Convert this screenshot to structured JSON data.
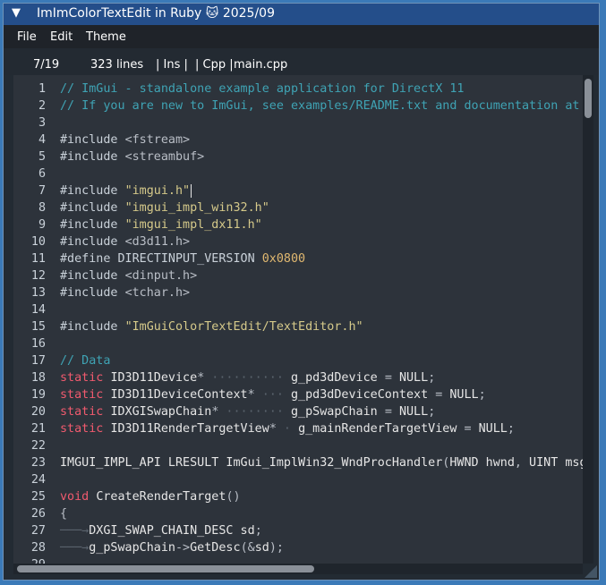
{
  "window": {
    "title": "ImImColorTextEdit in Ruby 🐱 2025/09",
    "collapse_glyph": "▼"
  },
  "menu": [
    {
      "label": "File"
    },
    {
      "label": "Edit"
    },
    {
      "label": "Theme"
    }
  ],
  "status": {
    "position": "7/19",
    "line_count": "323 lines",
    "mode": "| Ins |",
    "language": "| Cpp |",
    "filename": "main.cpp"
  },
  "colors": {
    "window_border": "#6f93b8",
    "titlebar": "#244e8a",
    "editor_bg": "#2d333b",
    "comment": "#3fa3b4",
    "string": "#d5c98a",
    "keyword": "#f05a6e",
    "number": "#e0b870"
  },
  "editor": {
    "cursor": {
      "line": 7,
      "column": 19
    },
    "lines": [
      {
        "n": "1",
        "tokens": [
          [
            "comment",
            "// ImGui - standalone example application for DirectX 11"
          ]
        ]
      },
      {
        "n": "2",
        "tokens": [
          [
            "comment",
            "// If you are new to ImGui, see examples/README.txt and documentation at the top"
          ]
        ]
      },
      {
        "n": "3",
        "tokens": []
      },
      {
        "n": "4",
        "tokens": [
          [
            "pre",
            "#include "
          ],
          [
            "punct",
            "<fstream>"
          ]
        ]
      },
      {
        "n": "5",
        "tokens": [
          [
            "pre",
            "#include "
          ],
          [
            "punct",
            "<streambuf>"
          ]
        ]
      },
      {
        "n": "6",
        "tokens": []
      },
      {
        "n": "7",
        "tokens": [
          [
            "pre",
            "#include "
          ],
          [
            "str",
            "\"imgui.h\""
          ]
        ],
        "cursor": true
      },
      {
        "n": "8",
        "tokens": [
          [
            "pre",
            "#include "
          ],
          [
            "str",
            "\"imgui_impl_win32.h\""
          ]
        ]
      },
      {
        "n": "9",
        "tokens": [
          [
            "pre",
            "#include "
          ],
          [
            "str",
            "\"imgui_impl_dx11.h\""
          ]
        ]
      },
      {
        "n": "10",
        "tokens": [
          [
            "pre",
            "#include "
          ],
          [
            "punct",
            "<d3d11.h>"
          ]
        ]
      },
      {
        "n": "11",
        "tokens": [
          [
            "pre",
            "#define DIRECTINPUT_VERSION "
          ],
          [
            "num",
            "0x0800"
          ]
        ]
      },
      {
        "n": "12",
        "tokens": [
          [
            "pre",
            "#include "
          ],
          [
            "punct",
            "<dinput.h>"
          ]
        ]
      },
      {
        "n": "13",
        "tokens": [
          [
            "pre",
            "#include "
          ],
          [
            "punct",
            "<tchar.h>"
          ]
        ]
      },
      {
        "n": "14",
        "tokens": []
      },
      {
        "n": "15",
        "tokens": [
          [
            "pre",
            "#include "
          ],
          [
            "str",
            "\"ImGuiColorTextEdit/TextEditor.h\""
          ]
        ]
      },
      {
        "n": "16",
        "tokens": []
      },
      {
        "n": "17",
        "tokens": [
          [
            "comment",
            "// Data"
          ]
        ]
      },
      {
        "n": "18",
        "tokens": [
          [
            "kw",
            "static "
          ],
          [
            "ident",
            "ID3D11Device"
          ],
          [
            "punct",
            "*"
          ],
          [
            "ws",
            " ·········· "
          ],
          [
            "ident",
            "g_pd3dDevice "
          ],
          [
            "punct",
            "= "
          ],
          [
            "ident",
            "NULL"
          ],
          [
            "punct",
            ";"
          ]
        ]
      },
      {
        "n": "19",
        "tokens": [
          [
            "kw",
            "static "
          ],
          [
            "ident",
            "ID3D11DeviceContext"
          ],
          [
            "punct",
            "*"
          ],
          [
            "ws",
            " ··· "
          ],
          [
            "ident",
            "g_pd3dDeviceContext "
          ],
          [
            "punct",
            "= "
          ],
          [
            "ident",
            "NULL"
          ],
          [
            "punct",
            ";"
          ]
        ]
      },
      {
        "n": "20",
        "tokens": [
          [
            "kw",
            "static "
          ],
          [
            "ident",
            "IDXGISwapChain"
          ],
          [
            "punct",
            "*"
          ],
          [
            "ws",
            " ········ "
          ],
          [
            "ident",
            "g_pSwapChain "
          ],
          [
            "punct",
            "= "
          ],
          [
            "ident",
            "NULL"
          ],
          [
            "punct",
            ";"
          ]
        ]
      },
      {
        "n": "21",
        "tokens": [
          [
            "kw",
            "static "
          ],
          [
            "ident",
            "ID3D11RenderTargetView"
          ],
          [
            "punct",
            "*"
          ],
          [
            "ws",
            " · "
          ],
          [
            "ident",
            "g_mainRenderTargetView "
          ],
          [
            "punct",
            "= "
          ],
          [
            "ident",
            "NULL"
          ],
          [
            "punct",
            ";"
          ]
        ]
      },
      {
        "n": "22",
        "tokens": []
      },
      {
        "n": "23",
        "tokens": [
          [
            "ident",
            "IMGUI_IMPL_API LRESULT ImGui_ImplWin32_WndProcHandler"
          ],
          [
            "punct",
            "("
          ],
          [
            "ident",
            "HWND hwnd"
          ],
          [
            "punct",
            ", "
          ],
          [
            "ident",
            "UINT msg"
          ],
          [
            "punct",
            ","
          ]
        ]
      },
      {
        "n": "24",
        "tokens": []
      },
      {
        "n": "25",
        "tokens": [
          [
            "kw",
            "void "
          ],
          [
            "ident",
            "CreateRenderTarget"
          ],
          [
            "punct",
            "()"
          ]
        ]
      },
      {
        "n": "26",
        "tokens": [
          [
            "punct",
            "{"
          ]
        ]
      },
      {
        "n": "27",
        "tokens": [
          [
            "ws",
            "───→"
          ],
          [
            "ident",
            "DXGI_SWAP_CHAIN_DESC sd"
          ],
          [
            "punct",
            ";"
          ]
        ]
      },
      {
        "n": "28",
        "tokens": [
          [
            "ws",
            "───→"
          ],
          [
            "ident",
            "g_pSwapChain"
          ],
          [
            "punct",
            "->"
          ],
          [
            "ident",
            "GetDesc"
          ],
          [
            "punct",
            "(&"
          ],
          [
            "ident",
            "sd"
          ],
          [
            "punct",
            ");"
          ]
        ]
      },
      {
        "n": "29",
        "tokens": []
      }
    ]
  }
}
